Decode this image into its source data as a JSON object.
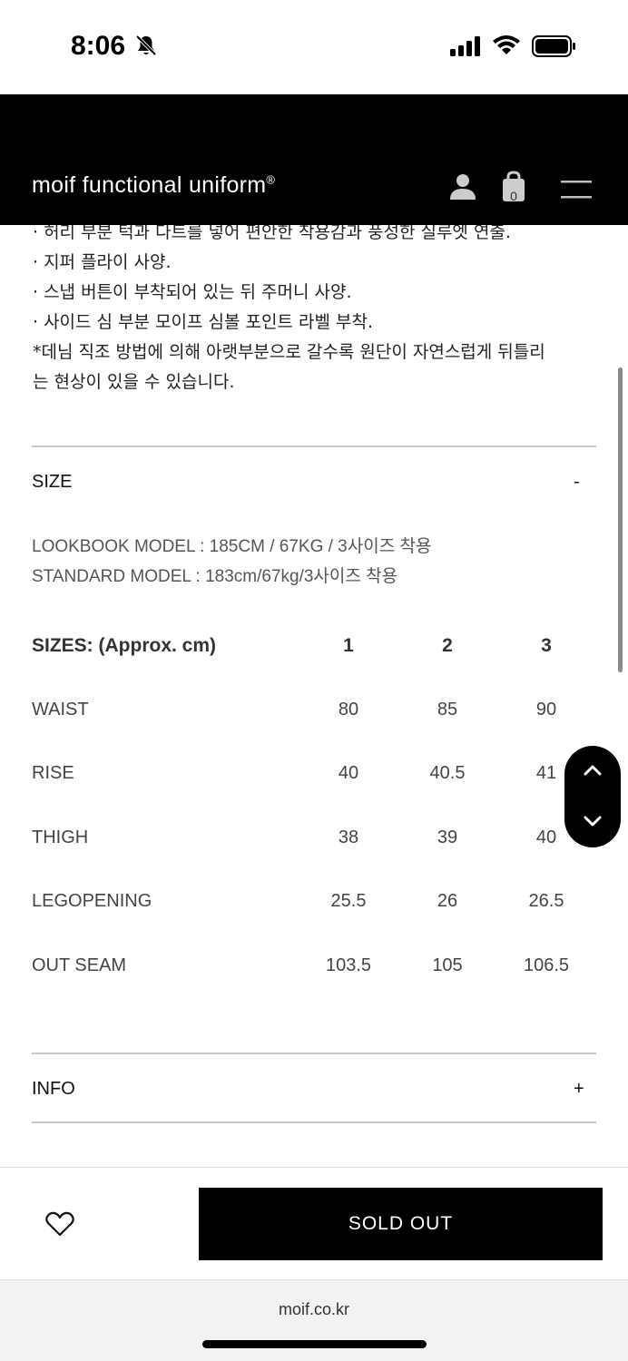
{
  "status_bar": {
    "time": "8:06"
  },
  "header": {
    "logo_text": "moif functional uniform",
    "logo_mark": "®",
    "cart_count": "0"
  },
  "description": {
    "lines": [
      "· 허리 부분 턱과 다트를 넣어 편안한 착용감과 풍성한 실루엣 연출.",
      "· 지퍼 플라이 사양.",
      "· 스냅 버튼이 부착되어 있는 뒤 주머니 사양.",
      "· 사이드 심 부분 모이프 심볼 포인트 라벨 부착.",
      "*데님 직조 방법에 의해 아랫부분으로 갈수록 원단이 자연스럽게 뒤틀리",
      "는 현상이 있을 수 있습니다."
    ]
  },
  "size_section": {
    "title": "SIZE",
    "toggle": "-",
    "lookbook_model": "LOOKBOOK MODEL : 185CM / 67KG / 3사이즈 착용",
    "standard_model": "STANDARD MODEL : 183cm/67kg/3사이즈 착용",
    "table": {
      "header": [
        "SIZES: (Approx. cm)",
        "1",
        "2",
        "3"
      ],
      "rows": [
        [
          "WAIST",
          "80",
          "85",
          "90"
        ],
        [
          "RISE",
          "40",
          "40.5",
          "41"
        ],
        [
          "THIGH",
          "38",
          "39",
          "40"
        ],
        [
          "LEGOPENING",
          "25.5",
          "26",
          "26.5"
        ],
        [
          "OUT SEAM",
          "103.5",
          "105",
          "106.5"
        ]
      ]
    }
  },
  "info_section": {
    "title": "INFO",
    "toggle": "+"
  },
  "bottom_bar": {
    "sold_out_label": "SOLD OUT"
  },
  "browser": {
    "url": "moif.co.kr"
  },
  "icons": {
    "bell": "bell-slash-icon",
    "signal": "signal-icon",
    "wifi": "wifi-icon",
    "battery": "battery-icon",
    "user": "user-icon",
    "cart": "shopping-bag-icon",
    "menu": "hamburger-menu-icon",
    "heart": "heart-icon",
    "scroll_up": "chevron-up-icon",
    "scroll_down": "chevron-down-icon"
  },
  "colors": {
    "header_bg": "#000000",
    "button_bg": "#000000",
    "divider": "#c9c9c9"
  }
}
